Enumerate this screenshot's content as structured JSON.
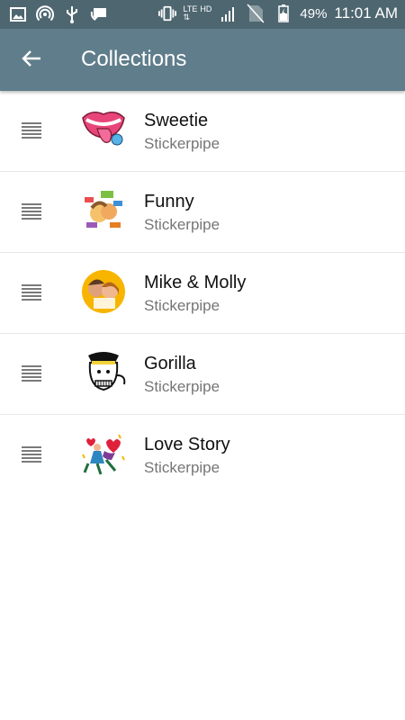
{
  "status_bar": {
    "network_label": "LTE",
    "network_label_2": "HD",
    "battery": "49%",
    "time": "11:01 AM"
  },
  "app_bar": {
    "back_icon": "arrow-back-icon",
    "title": "Collections"
  },
  "collections": [
    {
      "name": "Sweetie",
      "provider": "Stickerpipe",
      "icon": "lips-sticker"
    },
    {
      "name": "Funny",
      "provider": "Stickerpipe",
      "icon": "funny-sticker"
    },
    {
      "name": "Mike & Molly",
      "provider": "Stickerpipe",
      "icon": "couple-sticker"
    },
    {
      "name": "Gorilla",
      "provider": "Stickerpipe",
      "icon": "gorilla-sticker"
    },
    {
      "name": "Love Story",
      "provider": "Stickerpipe",
      "icon": "love-story-sticker"
    }
  ],
  "colors": {
    "status_bar": "#4e6670",
    "app_bar": "#607d8b",
    "divider": "#e6e6e6"
  }
}
